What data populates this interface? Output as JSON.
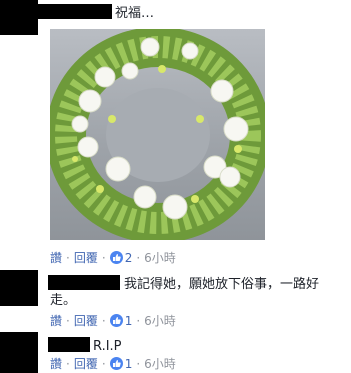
{
  "comment1": {
    "text": "祝福…",
    "actions": {
      "reply_label": "讚",
      "respond_label": "回覆",
      "likes": "2",
      "time": "6小時"
    }
  },
  "comment2": {
    "text_line1": "我記得她，願她放下俗事，一路好",
    "text_line2": "走。",
    "actions": {
      "reply_label": "讚",
      "respond_label": "回覆",
      "likes": "1",
      "time": "6小時"
    }
  },
  "comment3": {
    "text": "R.I.P",
    "actions": {
      "reply_label": "讚",
      "respond_label": "回覆",
      "likes": "1",
      "time": "6小時"
    }
  },
  "colors": {
    "link": "#4267b2",
    "like_badge": "#4b84f0",
    "meta": "#90949c"
  },
  "icons": {
    "like": "thumbs-up-icon",
    "wreath": "flower-wreath-image"
  }
}
